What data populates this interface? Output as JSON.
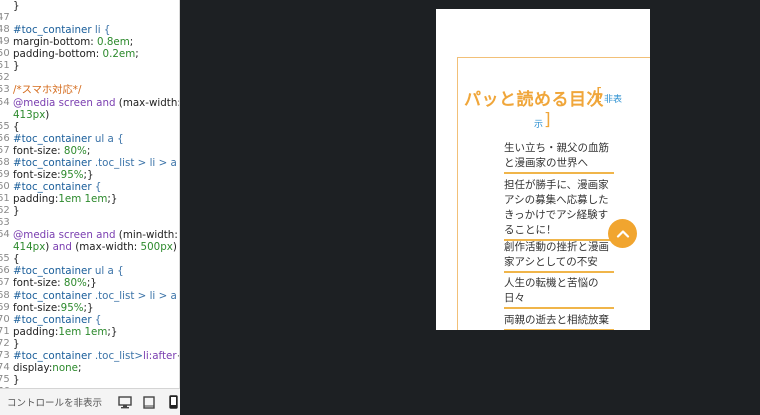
{
  "editor": {
    "lines": [
      {
        "n": "",
        "parts": [
          {
            "t": "}",
            "c": "pun"
          }
        ]
      },
      {
        "n": "47",
        "parts": []
      },
      {
        "n": "48",
        "parts": [
          {
            "t": "#toc_container",
            "c": "sel"
          },
          {
            "t": " li {",
            "c": "sel-sub"
          }
        ]
      },
      {
        "n": "49",
        "parts": [
          {
            "t": "margin-bottom: ",
            "c": "prop"
          },
          {
            "t": "0.8em",
            "c": "val"
          },
          {
            "t": ";",
            "c": "pun"
          }
        ]
      },
      {
        "n": "50",
        "parts": [
          {
            "t": "padding-bottom: ",
            "c": "prop"
          },
          {
            "t": "0.2em",
            "c": "val"
          },
          {
            "t": ";",
            "c": "pun"
          }
        ]
      },
      {
        "n": "51",
        "parts": [
          {
            "t": "}",
            "c": "pun"
          }
        ]
      },
      {
        "n": "52",
        "parts": []
      },
      {
        "n": "53",
        "parts": [
          {
            "t": "/*スマホ対応*/",
            "c": "cmt"
          }
        ]
      },
      {
        "n": "54",
        "parts": [
          {
            "t": "@media screen",
            "c": "at"
          },
          {
            "t": " and ",
            "c": "kw"
          },
          {
            "t": "(max-width:",
            "c": "pun"
          }
        ]
      },
      {
        "n": "",
        "parts": [
          {
            "t": "413px",
            "c": "num"
          },
          {
            "t": ")",
            "c": "pun"
          }
        ]
      },
      {
        "n": "55",
        "parts": [
          {
            "t": "{",
            "c": "pun"
          }
        ]
      },
      {
        "n": "56",
        "parts": [
          {
            "t": "#toc_container",
            "c": "sel"
          },
          {
            "t": " ul a  {",
            "c": "sel-sub"
          }
        ]
      },
      {
        "n": "57",
        "parts": [
          {
            "t": "font-size: ",
            "c": "prop"
          },
          {
            "t": "80%",
            "c": "val"
          },
          {
            "t": ";",
            "c": "pun"
          }
        ]
      },
      {
        "n": "58",
        "parts": [
          {
            "t": "#toc_container",
            "c": "sel"
          },
          {
            "t": " .toc_list > li > a {",
            "c": "sel-sub"
          }
        ]
      },
      {
        "n": "59",
        "parts": [
          {
            "t": "font-size:",
            "c": "prop"
          },
          {
            "t": "95%",
            "c": "val"
          },
          {
            "t": ";}",
            "c": "pun"
          }
        ]
      },
      {
        "n": "60",
        "parts": [
          {
            "t": "#toc_container",
            "c": "sel"
          },
          {
            "t": " {",
            "c": "sel-sub"
          }
        ]
      },
      {
        "n": "61",
        "parts": [
          {
            "t": "padding:",
            "c": "prop"
          },
          {
            "t": "1em 1em",
            "c": "val"
          },
          {
            "t": ";}",
            "c": "pun"
          }
        ]
      },
      {
        "n": "62",
        "parts": [
          {
            "t": "}",
            "c": "pun"
          }
        ]
      },
      {
        "n": "63",
        "parts": []
      },
      {
        "n": "64",
        "parts": [
          {
            "t": "@media screen",
            "c": "at"
          },
          {
            "t": " and ",
            "c": "kw"
          },
          {
            "t": "(min-width:",
            "c": "pun"
          }
        ]
      },
      {
        "n": "",
        "parts": [
          {
            "t": "414px",
            "c": "num"
          },
          {
            "t": ") ",
            "c": "pun"
          },
          {
            "t": "and",
            "c": "kw"
          },
          {
            "t": " (max-width: ",
            "c": "pun"
          },
          {
            "t": "500px",
            "c": "num"
          },
          {
            "t": ")",
            "c": "pun"
          }
        ]
      },
      {
        "n": "65",
        "parts": [
          {
            "t": "{",
            "c": "pun"
          }
        ]
      },
      {
        "n": "66",
        "parts": [
          {
            "t": "#toc_container",
            "c": "sel"
          },
          {
            "t": " ul a  {",
            "c": "sel-sub"
          }
        ]
      },
      {
        "n": "67",
        "parts": [
          {
            "t": "font-size: ",
            "c": "prop"
          },
          {
            "t": "80%",
            "c": "val"
          },
          {
            "t": ";}",
            "c": "pun"
          }
        ]
      },
      {
        "n": "68",
        "parts": [
          {
            "t": "#toc_container",
            "c": "sel"
          },
          {
            "t": " .toc_list > li > a {",
            "c": "sel-sub"
          }
        ]
      },
      {
        "n": "69",
        "parts": [
          {
            "t": "font-size:",
            "c": "prop"
          },
          {
            "t": "95%",
            "c": "val"
          },
          {
            "t": ";}",
            "c": "pun"
          }
        ]
      },
      {
        "n": "70",
        "parts": [
          {
            "t": "#toc_container",
            "c": "sel"
          },
          {
            "t": " {",
            "c": "sel-sub"
          }
        ]
      },
      {
        "n": "71",
        "parts": [
          {
            "t": "padding:",
            "c": "prop"
          },
          {
            "t": "1em 1em",
            "c": "val"
          },
          {
            "t": ";}",
            "c": "pun"
          }
        ]
      },
      {
        "n": "72",
        "parts": [
          {
            "t": "}",
            "c": "pun"
          }
        ]
      },
      {
        "n": "73",
        "parts": [
          {
            "t": "#toc_container",
            "c": "sel"
          },
          {
            "t": " .toc_list>",
            "c": "sel-sub"
          },
          {
            "t": "li:after",
            "c": "kw"
          },
          {
            "t": "{",
            "c": "pun"
          }
        ]
      },
      {
        "n": "74",
        "parts": [
          {
            "t": "display:",
            "c": "prop"
          },
          {
            "t": "none",
            "c": "val"
          },
          {
            "t": ";",
            "c": "pun"
          }
        ]
      },
      {
        "n": "75",
        "parts": [
          {
            "t": "}",
            "c": "pun"
          }
        ]
      },
      {
        "n": "76",
        "parts": []
      }
    ]
  },
  "controls": {
    "hide_label": "コントロールを非表示"
  },
  "preview": {
    "toc_title": "パッと読める目次",
    "bracket_open": "[",
    "bracket_close": "]",
    "toggle_part1": "非表",
    "toggle_part2": "示",
    "items": [
      "生い立ち・親父の血筋と漫画家の世界へ",
      "担任が勝手に、漫画家アシの募集へ応募したきっかけでアシ経験することに！",
      "創作活動の挫折と漫画家アシとしての不安",
      "人生の転機と苦悩の日々",
      "両親の逝去と相続放棄"
    ]
  },
  "colors": {
    "accent": "#f0a63a",
    "link": "#2a8fd0",
    "background": "#1d2023"
  }
}
